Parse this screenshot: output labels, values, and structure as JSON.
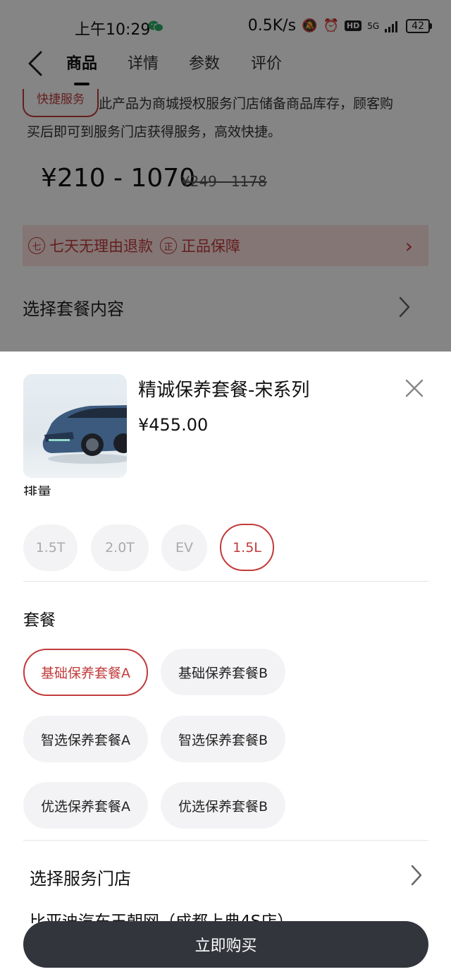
{
  "status_bar": {
    "time": "上午10:29",
    "network_speed": "0.5K/s",
    "signal": "5G",
    "battery": "42"
  },
  "nav": {
    "tabs": [
      "商品",
      "详情",
      "参数",
      "评价"
    ],
    "active_tab": "商品"
  },
  "service": {
    "badge": "快捷服务",
    "text_line1": "此产品为商城授权服务门店储备商品库存，顾客购",
    "text_line2": "买后即可到服务门店获得服务，高效快捷。"
  },
  "pricing": {
    "range": "¥210 - 1070",
    "original_range": "¥249 - 1178"
  },
  "guarantees": [
    {
      "icon_char": "七",
      "label": "七天无理由退款"
    },
    {
      "icon_char": "正",
      "label": "正品保障"
    }
  ],
  "choose_package_label": "选择套餐内容",
  "sheet": {
    "product_title": "精诚保养套餐-宋系列",
    "product_price": "¥455.00",
    "displacement_label": "排量",
    "displacement_options": [
      {
        "label": "1.5T",
        "selected": false
      },
      {
        "label": "2.0T",
        "selected": false
      },
      {
        "label": "EV",
        "selected": false
      },
      {
        "label": "1.5L",
        "selected": true
      }
    ],
    "package_label": "套餐",
    "package_options": [
      {
        "label": "基础保养套餐A",
        "selected": true
      },
      {
        "label": "基础保养套餐B",
        "selected": false
      },
      {
        "label": "智选保养套餐A",
        "selected": false
      },
      {
        "label": "智选保养套餐B",
        "selected": false
      },
      {
        "label": "优选保养套餐A",
        "selected": false
      },
      {
        "label": "优选保养套餐B",
        "selected": false
      }
    ],
    "store_label": "选择服务门店",
    "store_name": "比亚迪汽车王朝网（成都上典4S店）",
    "buy_button": "立即购买"
  },
  "colors": {
    "accent_red": "#c23b3b",
    "buy_button_bg": "#33353c",
    "chip_bg": "#f3f3f5"
  }
}
